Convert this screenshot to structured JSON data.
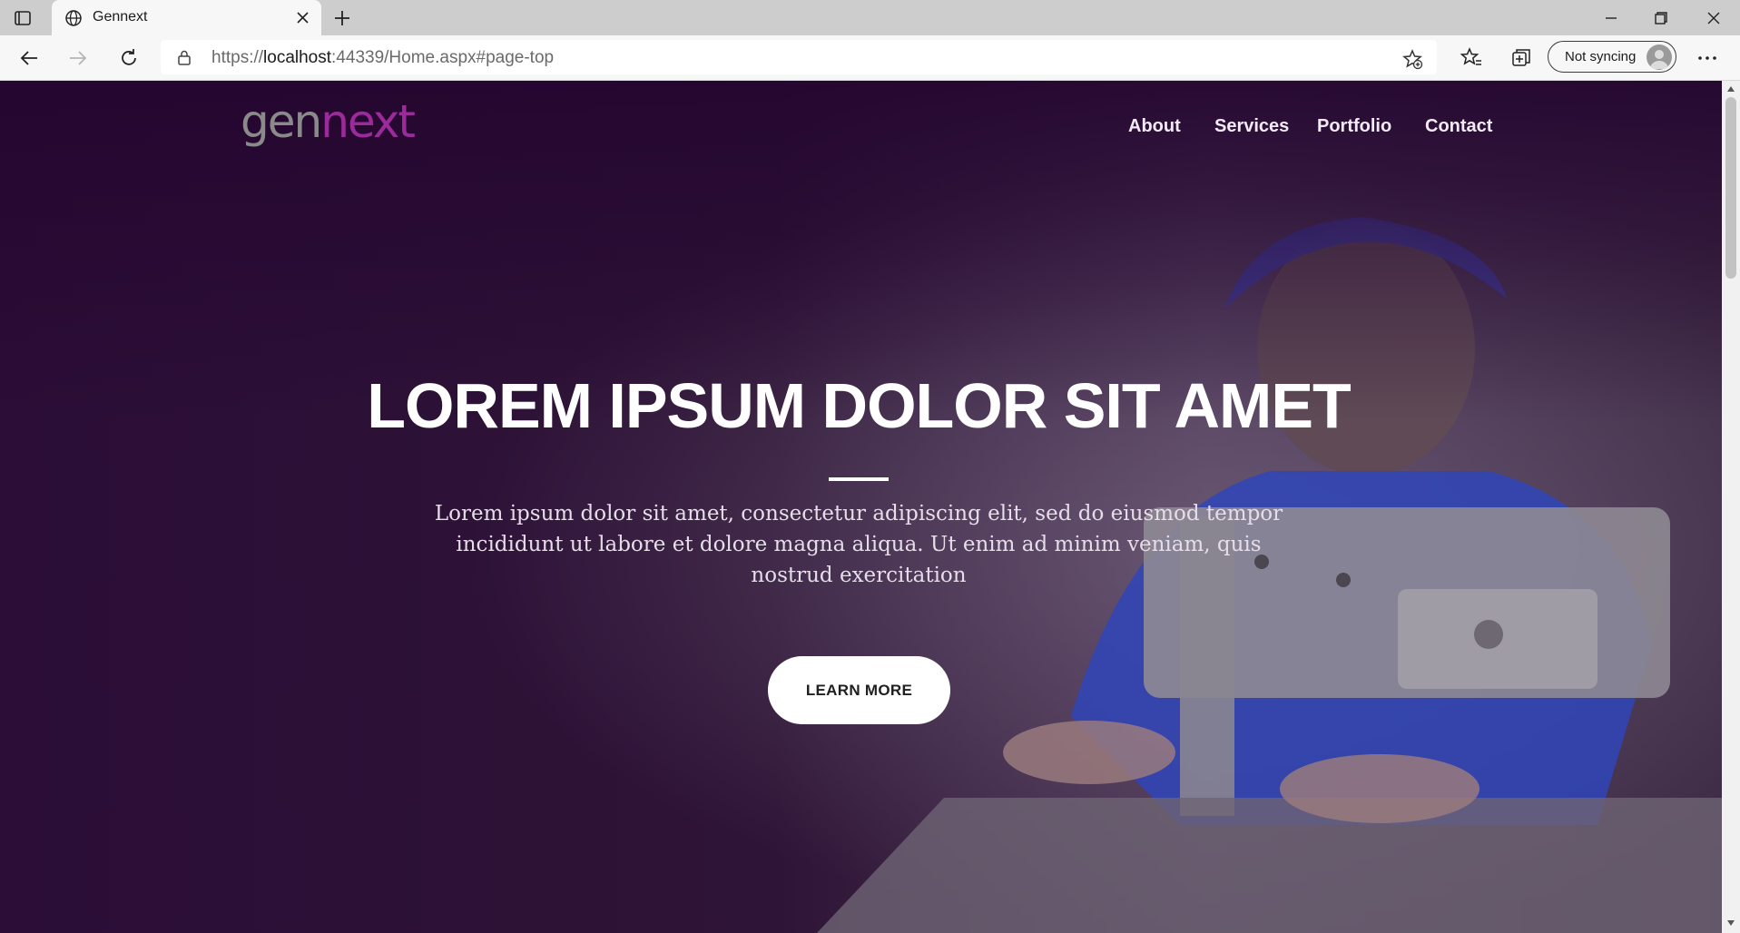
{
  "browser": {
    "tab_title": "Gennext",
    "url_prefix": "https://",
    "url_host": "localhost",
    "url_rest": ":44339/Home.aspx#page-top",
    "sync_label": "Not syncing"
  },
  "site": {
    "logo_gen": "gen",
    "logo_next": "next",
    "nav": [
      "About",
      "Services",
      "Portfolio",
      "Contact"
    ]
  },
  "hero": {
    "title": "LOREM IPSUM DOLOR SIT AMET",
    "text": "Lorem ipsum dolor sit amet, consectetur adipiscing elit, sed do eiusmod tempor incididunt ut labore et dolore magna aliqua. Ut enim ad minim veniam, quis nostrud exercitation",
    "button": "LEARN MORE"
  },
  "colors": {
    "hero_overlay": "#2a0f36",
    "logo_accent": "#9b2a9a",
    "logo_gray": "#8a8a8a"
  }
}
